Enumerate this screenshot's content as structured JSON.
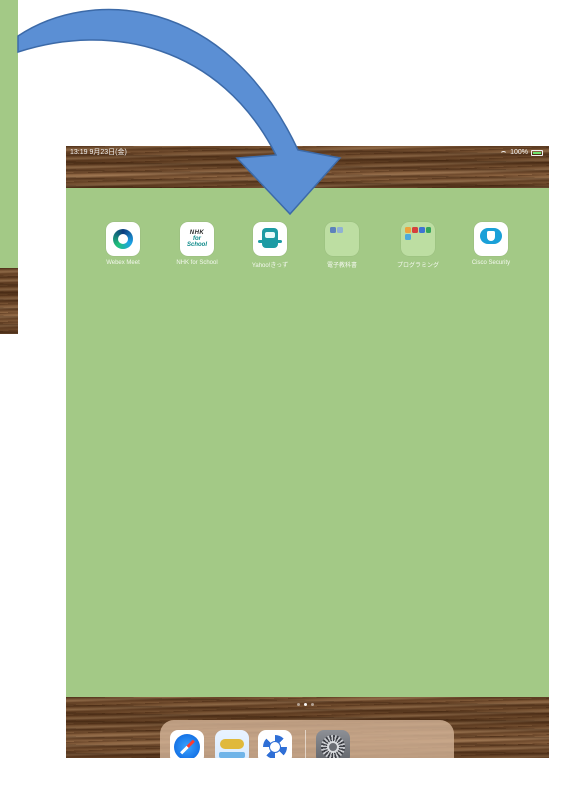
{
  "status_bar": {
    "time": "13:19",
    "date": "9月23日(金)",
    "battery_percent": "100%"
  },
  "apps": [
    {
      "label": "Webex Meet",
      "icon": "webex-meet-icon"
    },
    {
      "label": "NHK for School",
      "icon": "nhk-for-school-icon",
      "icon_text": [
        "NHK",
        "for",
        "School"
      ]
    },
    {
      "label": "Yahoo!きっず",
      "icon": "yahoo-kids-icon"
    },
    {
      "label": "電子教科書",
      "icon": "folder-icon"
    },
    {
      "label": "プログラミング",
      "icon": "folder-icon"
    },
    {
      "label": "Cisco Security",
      "icon": "cisco-security-icon"
    }
  ],
  "page_dots": {
    "count": 3,
    "active_index": 1
  },
  "dock": [
    {
      "name": "safari-icon"
    },
    {
      "name": "learning-app-icon"
    },
    {
      "name": "help-lifebuoy-icon"
    },
    {
      "name": "settings-icon"
    }
  ],
  "colors": {
    "wallpaper_green": "#a3c986",
    "arrow_blue": "#5b8fd4",
    "arrow_outline": "#3c6aa8"
  }
}
